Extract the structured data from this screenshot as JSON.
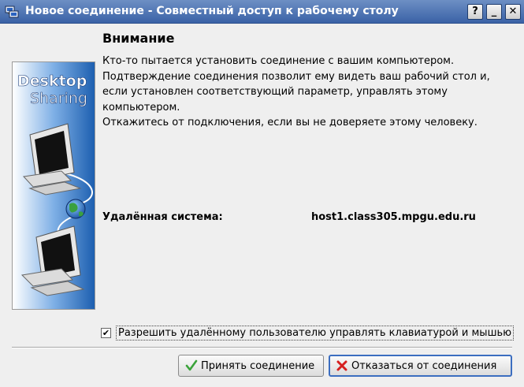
{
  "window": {
    "title": "Новое соединение - Совместный доступ к рабочему столу",
    "help_label": "?",
    "minimize_label": "_",
    "close_label": "✕"
  },
  "banner": {
    "line1": "Desktop",
    "line2": "Sharing"
  },
  "content": {
    "heading": "Внимание",
    "message_lines": [
      "Кто-то пытается установить соединение с вашим компьютером.",
      "Подтверждение соединения позволит ему видеть ваш рабочий стол и,",
      "если установлен соответствующий параметр, управлять этому компьютером.",
      "Откажитесь от подключения, если вы не доверяете этому человеку."
    ],
    "remote_label": "Удалённая система:",
    "remote_value": "host1.class305.mpgu.edu.ru"
  },
  "options": {
    "allow_control_label": "Разрешить удалённому пользователю управлять клавиатурой и мышью",
    "allow_control_checked": true,
    "check_mark": "✔"
  },
  "buttons": {
    "accept_label": "Принять соединение",
    "reject_label": "Отказаться от соединения"
  },
  "colors": {
    "titlebar": "#3a62a6",
    "banner_blue": "#1d5fb0",
    "accept_icon": "#3aa33a",
    "reject_icon": "#d62020"
  },
  "icons": {
    "app": "desktop-sharing-icon",
    "accept": "checkmark-icon",
    "reject": "cross-icon",
    "banner": "network-computers-illustration"
  }
}
